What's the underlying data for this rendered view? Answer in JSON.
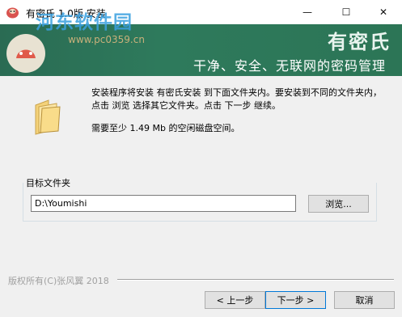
{
  "window": {
    "title": "有密氏 1.0版 安装",
    "minimize": "—",
    "maximize": "☐",
    "close": "✕"
  },
  "watermark": {
    "text": "河东软件园",
    "url": "www.pc0359.cn"
  },
  "banner": {
    "brand": "有密氏",
    "slogan": "干净、安全、无联网的密码管理"
  },
  "content": {
    "description": "安装程序将安装 有密氏安装 到下面文件夹内。要安装到不同的文件夹内，点击 浏览 选择其它文件夹。点击 下一步 继续。",
    "space_required": "需要至少 1.49 Mb 的空闲磁盘空间。"
  },
  "destination": {
    "label": "目标文件夹",
    "path": "D:\\Youmishi",
    "browse_label": "浏览..."
  },
  "footer": {
    "copyright": "版权所有(C)张风翼 2018",
    "back_label": "< 上一步",
    "next_label": "下一步 >",
    "cancel_label": "取消"
  },
  "colors": {
    "banner": "#2e7a5c",
    "accent": "#0078d7"
  }
}
